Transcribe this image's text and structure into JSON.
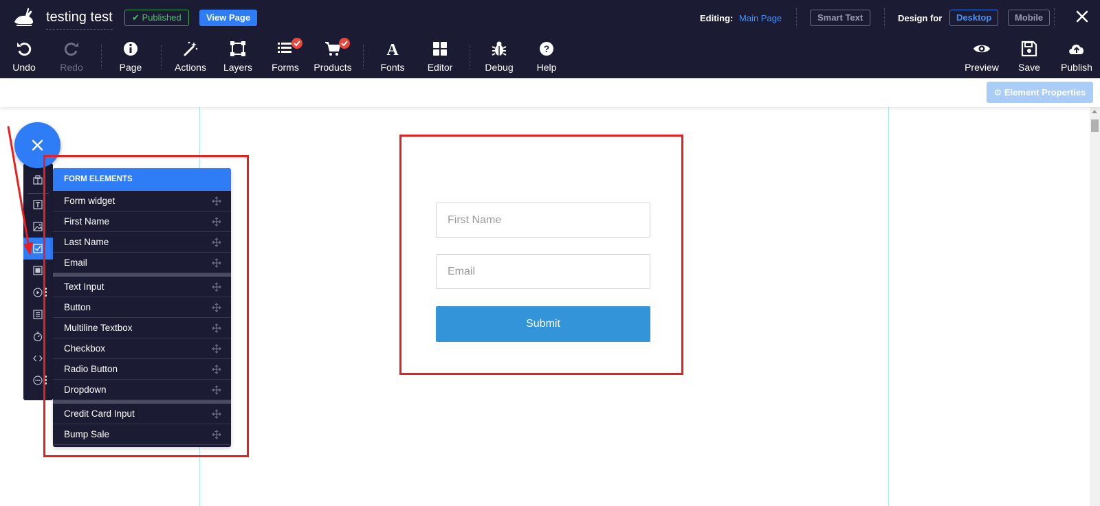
{
  "header": {
    "page_title": "testing test",
    "published_label": "Published",
    "view_page_label": "View Page",
    "editing_label": "Editing:",
    "editing_value": "Main Page",
    "smart_text_label": "Smart Text",
    "design_for_label": "Design for",
    "desktop_label": "Desktop",
    "mobile_label": "Mobile"
  },
  "toolbar": {
    "undo": "Undo",
    "redo": "Redo",
    "page": "Page",
    "actions": "Actions",
    "layers": "Layers",
    "forms": "Forms",
    "products": "Products",
    "fonts": "Fonts",
    "editor": "Editor",
    "debug": "Debug",
    "help": "Help",
    "preview": "Preview",
    "save": "Save",
    "publish": "Publish"
  },
  "subbar": {
    "element_properties_label": "Element Properties"
  },
  "elements_panel": {
    "header": "FORM ELEMENTS",
    "items": [
      "Form widget",
      "First Name",
      "Last Name",
      "Email",
      "Text Input",
      "Button",
      "Multiline Textbox",
      "Checkbox",
      "Radio Button",
      "Dropdown",
      "Credit Card Input",
      "Bump Sale"
    ]
  },
  "form": {
    "first_name_placeholder": "First Name",
    "email_placeholder": "Email",
    "submit_label": "Submit"
  },
  "colors": {
    "topbar_bg": "#1b1c33",
    "accent_blue": "#2e7cf6",
    "submit_blue": "#3394da",
    "highlight_red": "#e81f1f",
    "published_green": "#3aa655",
    "badge_red": "#e8483c"
  },
  "icons": {
    "fab": "close-icon",
    "rail": [
      "structure-icon",
      "text-icon",
      "image-icon",
      "checkbox-icon",
      "box-icon",
      "video-icon",
      "list-icon",
      "timer-icon",
      "code-icon",
      "more-icon"
    ]
  }
}
